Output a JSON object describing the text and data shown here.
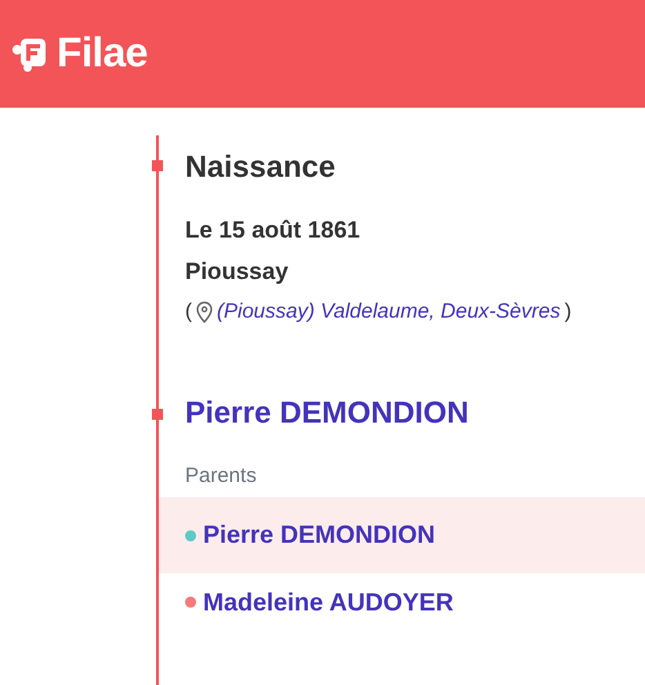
{
  "header": {
    "logo": "Filae"
  },
  "event": {
    "title": "Naissance",
    "date": "Le 15 août 1861",
    "place": "Pioussay",
    "location_open": "(",
    "location_link": "(Pioussay) Valdelaume, Deux-Sèvres",
    "location_close": ")"
  },
  "person": {
    "name": "Pierre DEMONDION"
  },
  "parents": {
    "label": "Parents",
    "items": [
      {
        "name": "Pierre DEMONDION",
        "color": "#5ec9c6",
        "selected": true
      },
      {
        "name": "Madeleine AUDOYER",
        "color": "#f27c7c",
        "selected": false
      }
    ]
  }
}
